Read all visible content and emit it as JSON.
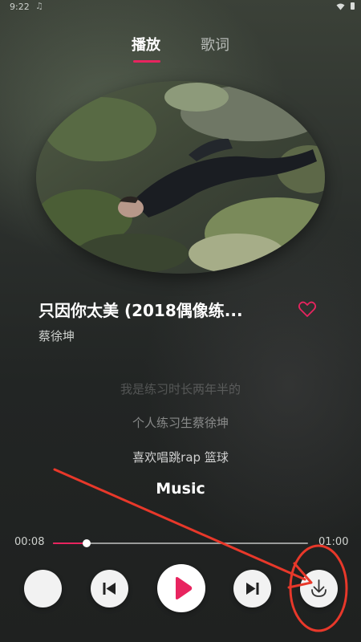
{
  "status_bar": {
    "time": "9:22"
  },
  "tabs": [
    {
      "label": "播放",
      "active": true
    },
    {
      "label": "歌词",
      "active": false
    }
  ],
  "song": {
    "title": "只因你太美 (2018偶像练...",
    "singer": "蔡徐坤",
    "liked": false
  },
  "lyrics": [
    "我是练习时长两年半的",
    "个人练习生蔡徐坤",
    "喜欢唱跳rap 篮球",
    "Music"
  ],
  "playback": {
    "current_time": "00:08",
    "total_time": "01:00",
    "progress": 0.133
  },
  "controls": {
    "mode_icon": "blank-circle",
    "prev_icon": "skip-previous-icon",
    "play_icon": "play-icon",
    "next_icon": "skip-next-icon",
    "download_icon": "download-icon"
  },
  "colors": {
    "accent": "#e8245f",
    "annotation": "#e8382a"
  }
}
